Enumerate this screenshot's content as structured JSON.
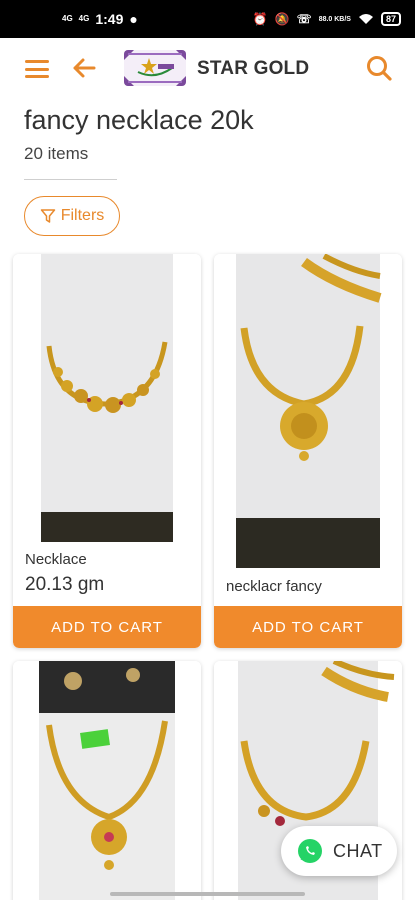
{
  "status_bar": {
    "time": "1:49",
    "net1": "4G",
    "net2": "4G",
    "speed": "88.0 KB/S",
    "battery": "87"
  },
  "app_bar": {
    "brand": "STAR GOLD",
    "logo_text": "STAR GOLD"
  },
  "page": {
    "title": "fancy necklace 20k",
    "count": "20 items",
    "filters_label": "Filters"
  },
  "products": [
    {
      "name": "Necklace",
      "weight": "20.13 gm",
      "cart_label": "ADD TO CART"
    },
    {
      "name": "necklacr fancy",
      "weight": "",
      "cart_label": "ADD TO CART"
    },
    {
      "name": "",
      "weight": "",
      "cart_label": ""
    },
    {
      "name": "",
      "weight": "",
      "cart_label": ""
    }
  ],
  "chat": {
    "label": "CHAT"
  },
  "colors": {
    "accent": "#e8892c",
    "cart_button": "#f08a2c",
    "whatsapp": "#25d366"
  },
  "icons": [
    "menu-icon",
    "back-arrow-icon",
    "search-icon",
    "filter-icon",
    "whatsapp-icon"
  ]
}
